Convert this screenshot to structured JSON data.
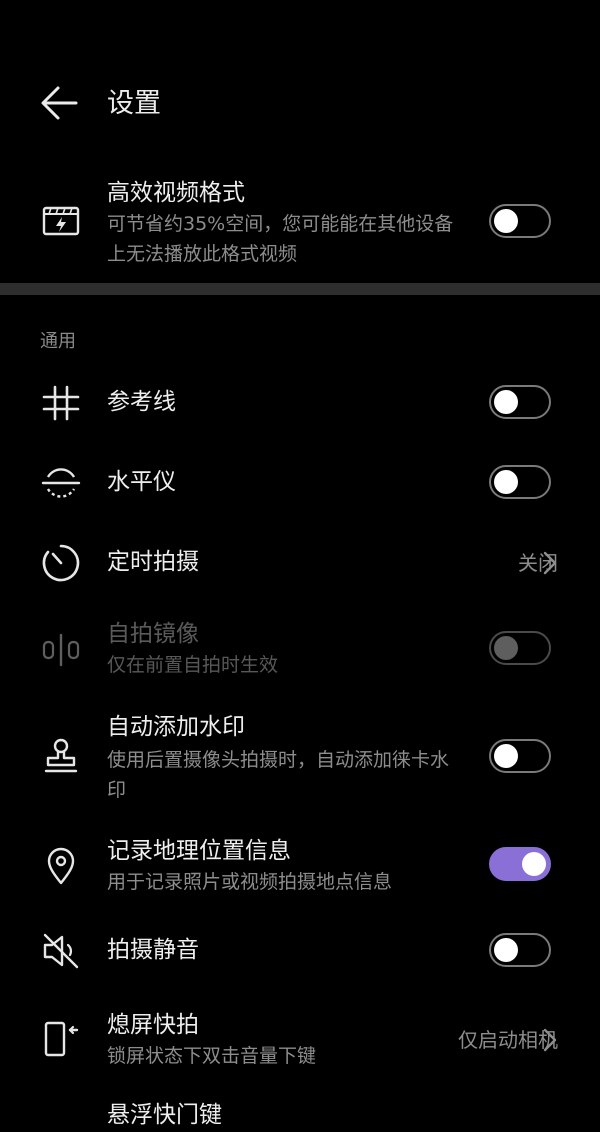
{
  "header": {
    "title": "设置"
  },
  "efficient_format": {
    "title": "高效视频格式",
    "subtitle": "可节省约35%空间，您可能能在其他设备上无法播放此格式视频",
    "on": false
  },
  "section": {
    "general": "通用"
  },
  "items": [
    {
      "title": "参考线",
      "on": false
    },
    {
      "title": "水平仪",
      "on": false
    },
    {
      "title": "定时拍摄",
      "value": "关闭"
    },
    {
      "title": "自拍镜像",
      "subtitle": "仅在前置自拍时生效",
      "on": true,
      "disabled": true
    },
    {
      "title": "自动添加水印",
      "subtitle": "使用后置摄像头拍摄时，自动添加徕卡水印",
      "on": false
    },
    {
      "title": "记录地理位置信息",
      "subtitle": "用于记录照片或视频拍摄地点信息",
      "on": true
    },
    {
      "title": "拍摄静音",
      "on": false
    },
    {
      "title": "熄屏快拍",
      "subtitle": "锁屏状态下双击音量下键",
      "value": "仅启动相机"
    },
    {
      "title": "悬浮快门键"
    }
  ],
  "colors": {
    "accent": "#8a6fd6",
    "background": "#000000",
    "secondary_text": "#8d8d8d"
  }
}
